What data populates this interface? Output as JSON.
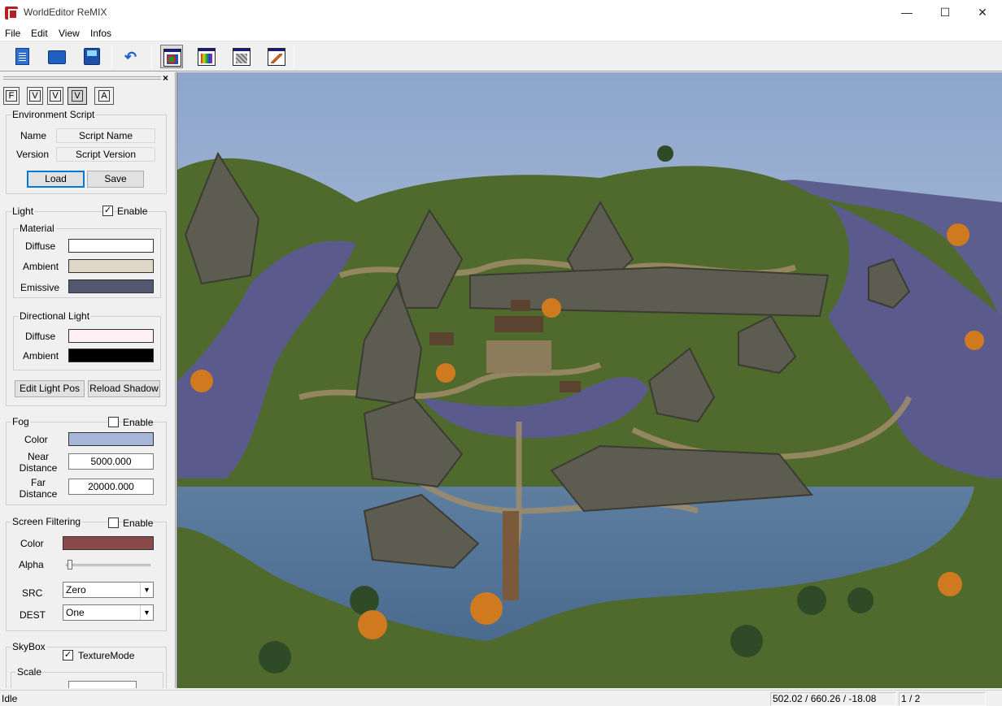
{
  "window": {
    "title": "WorldEditor ReMIX",
    "minimize": "—",
    "maximize": "☐",
    "close": "✕"
  },
  "menu": [
    "File",
    "Edit",
    "View",
    "Infos"
  ],
  "toolbar": {
    "buttons": [
      "new-document",
      "open-folder",
      "save",
      "undo",
      "object-view",
      "texture-view",
      "attribute-view",
      "paint-view"
    ]
  },
  "panel": {
    "close": "×",
    "mode_tabs": [
      "F",
      "V",
      "V",
      "V",
      "A"
    ],
    "env_script": {
      "title": "Environment Script",
      "name_label": "Name",
      "name_value": "Script Name",
      "version_label": "Version",
      "version_value": "Script Version",
      "load": "Load",
      "save": "Save"
    },
    "light": {
      "title": "Light",
      "enable_label": "Enable",
      "enabled": true,
      "material_title": "Material",
      "diffuse_label": "Diffuse",
      "diffuse_color": "#ffffff",
      "ambient_label": "Ambient",
      "ambient_color": "#ded6c6",
      "emissive_label": "Emissive",
      "emissive_color": "#525870",
      "directional_title": "Directional Light",
      "dir_diffuse_label": "Diffuse",
      "dir_diffuse_color": "#fff0f4",
      "dir_ambient_label": "Ambient",
      "dir_ambient_color": "#000000",
      "edit_light_pos": "Edit Light Pos",
      "reload_shadow": "Reload Shadow"
    },
    "fog": {
      "title": "Fog",
      "enable_label": "Enable",
      "enabled": false,
      "color_label": "Color",
      "color": "#a7b5d9",
      "near_label_1": "Near",
      "near_label_2": "Distance",
      "near_value": "5000.000",
      "far_label_1": "Far",
      "far_label_2": "Distance",
      "far_value": "20000.000"
    },
    "screen_filtering": {
      "title": "Screen Filtering",
      "enable_label": "Enable",
      "enabled": false,
      "color_label": "Color",
      "color": "#8a4a4a",
      "alpha_label": "Alpha",
      "alpha_value": 0,
      "src_label": "SRC",
      "src_value": "Zero",
      "dest_label": "DEST",
      "dest_value": "One"
    },
    "skybox": {
      "title": "SkyBox",
      "texture_mode_label": "TextureMode",
      "texture_mode": true,
      "scale_title": "Scale"
    }
  },
  "status": {
    "text": "Idle",
    "coords": "502.02 / 660.26 / -18.08",
    "page": "1 / 2"
  }
}
